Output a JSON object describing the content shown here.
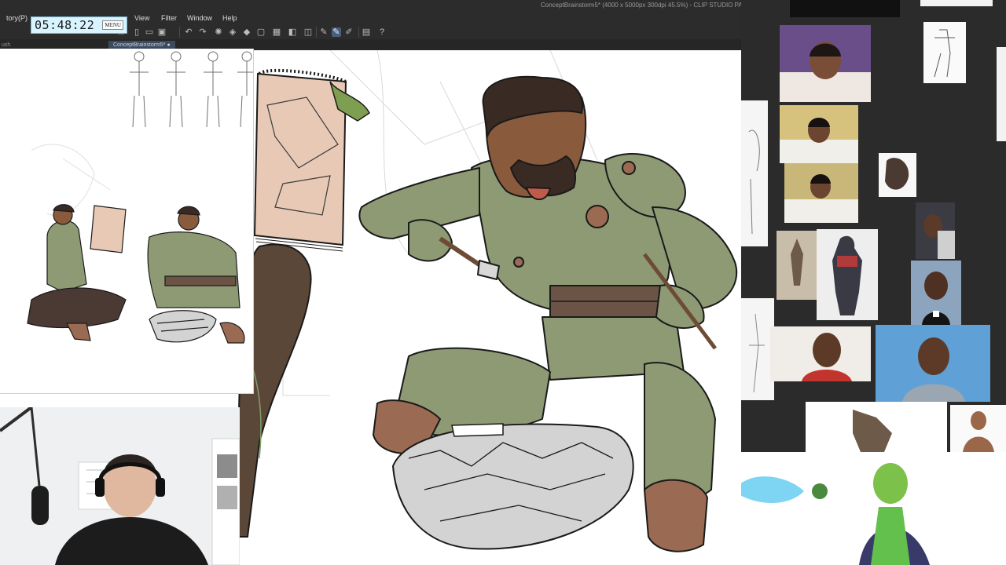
{
  "app": {
    "title": "ConceptBrainstorm5* (4000 x 5000px 300dpi 45.5%) - CLIP STUDIO PA",
    "menu": {
      "story_cut": "tory(P)",
      "view": "View",
      "filter": "Filter",
      "window": "Window",
      "help": "Help"
    },
    "doc_tab": "ConceptBrainstorm5* ●",
    "left_tab": "ush"
  },
  "timer": {
    "value": "05:48:22",
    "menu_label": "MENU"
  },
  "toolbar": {
    "icons": [
      "new-file-icon",
      "open-file-icon",
      "save-icon",
      "undo-icon",
      "redo-icon",
      "spinner-icon",
      "fill-icon",
      "layer-icon",
      "grid-icon",
      "transform-icon",
      "pen-icon",
      "pen-active-icon",
      "edit-icon",
      "sidebar-icon",
      "help-icon"
    ]
  },
  "colors": {
    "app_bar": "#2c2c2c",
    "armor_green": "#8e9a74",
    "armor_dark": "#6d7a5e",
    "leather": "#9a6a52",
    "skin": "#8a5a3c",
    "hair": "#3a2a24",
    "notepad": "#e8c9b6",
    "ref_panel": "#2b2b2b",
    "timer_bg": "#d7f4ff"
  }
}
